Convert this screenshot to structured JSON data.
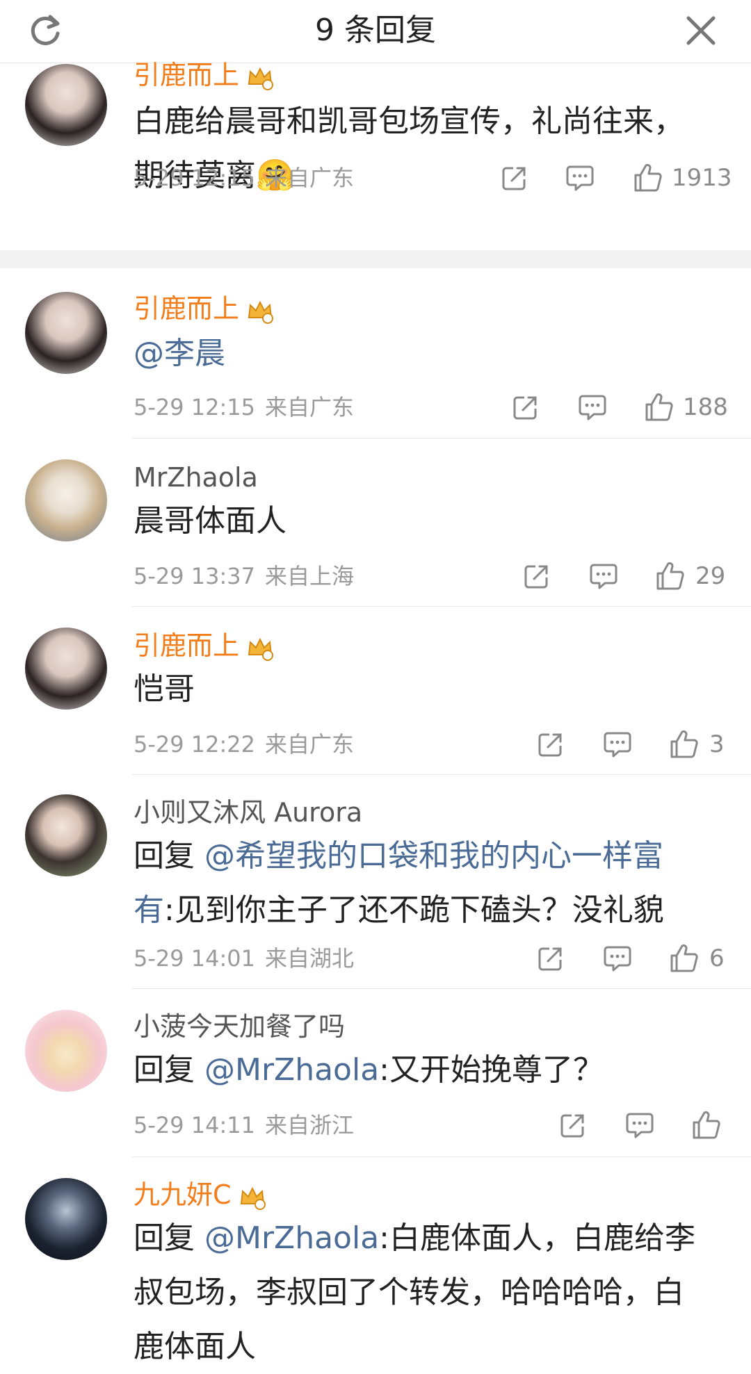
{
  "header": {
    "title": "9 条回复"
  },
  "comments": [
    {
      "user": "引鹿而上",
      "text": "白鹿给晨哥和凯哥包场宣传，礼尚往来，期待莫离",
      "emoji": "🤗",
      "date": "5-29 12:15",
      "location": "来自广东",
      "likes": "1913"
    },
    {
      "user": "引鹿而上",
      "text_mention": "@李晨",
      "date": "5-29 12:15",
      "location": "来自广东",
      "likes": "188"
    },
    {
      "user": "MrZhaola",
      "text": "晨哥体面人",
      "date": "5-29 13:37",
      "location": "来自上海",
      "likes": "29"
    },
    {
      "user": "引鹿而上",
      "text": "恺哥",
      "date": "5-29 12:22",
      "location": "来自广东",
      "likes": "3"
    },
    {
      "user": "小则又沐风 Aurora",
      "reply_prefix": "回复 ",
      "mention": "@希望我的口袋和我的内心一样富有",
      "text": ":见到你主子了还不跪下磕头？没礼貌",
      "date": "5-29 14:01",
      "location": "来自湖北",
      "likes": "6"
    },
    {
      "user": "小菠今天加餐了吗",
      "reply_prefix": "回复 ",
      "mention": "@MrZhaola",
      "text": ":又开始挽尊了？",
      "date": "5-29 14:11",
      "location": "来自浙江"
    },
    {
      "user": "九九妍C",
      "reply_prefix": "回复 ",
      "mention": "@MrZhaola",
      "text": ":白鹿体面人，白鹿给李叔包场，李叔回了个转发，哈哈哈哈，白鹿体面人"
    }
  ],
  "icons": {
    "refresh": "refresh-icon",
    "close": "close-icon",
    "share": "share-icon",
    "comment": "comment-icon",
    "like": "thumbs-up-icon",
    "crown": "vip-crown-icon"
  },
  "colors": {
    "vip_name": "#f27d1a",
    "mention": "#4a6b96",
    "meta": "#9a9a9a"
  }
}
